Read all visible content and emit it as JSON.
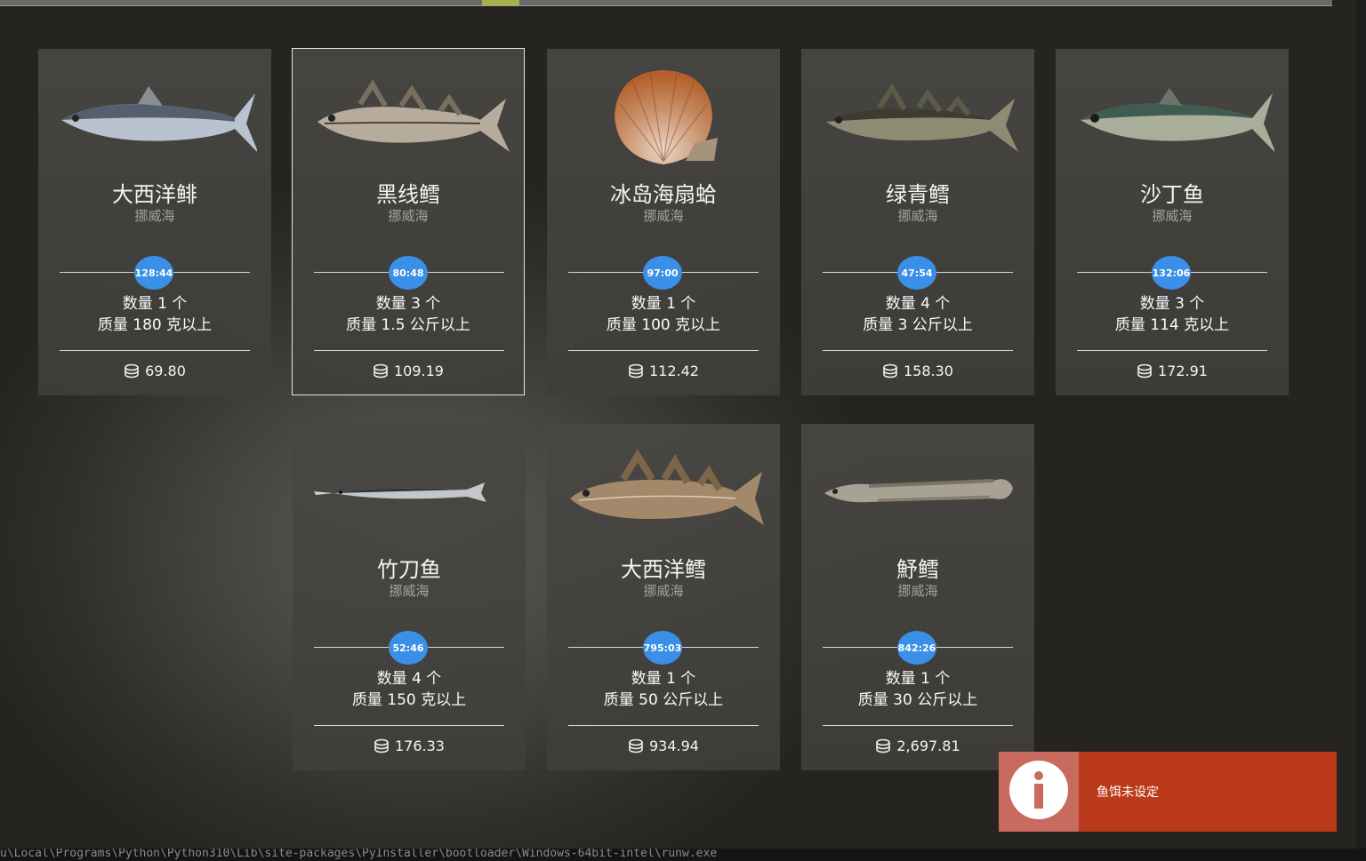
{
  "cards": [
    {
      "name": "大西洋鲱",
      "region": "挪威海",
      "timer": "128:44",
      "qty": "数量 1 个",
      "weight": "质量 180 克以上",
      "price": "69.80"
    },
    {
      "name": "黑线鳕",
      "region": "挪威海",
      "timer": "80:48",
      "qty": "数量 3 个",
      "weight": "质量 1.5 公斤以上",
      "price": "109.19"
    },
    {
      "name": "冰岛海扇蛤",
      "region": "挪威海",
      "timer": "97:00",
      "qty": "数量 1 个",
      "weight": "质量 100 克以上",
      "price": "112.42"
    },
    {
      "name": "绿青鳕",
      "region": "挪威海",
      "timer": "47:54",
      "qty": "数量 4 个",
      "weight": "质量 3 公斤以上",
      "price": "158.30"
    },
    {
      "name": "沙丁鱼",
      "region": "挪威海",
      "timer": "132:06",
      "qty": "数量 3 个",
      "weight": "质量 114 克以上",
      "price": "172.91"
    },
    {
      "name": "竹刀鱼",
      "region": "挪威海",
      "timer": "52:46",
      "qty": "数量 4 个",
      "weight": "质量 150 克以上",
      "price": "176.33"
    },
    {
      "name": "大西洋鳕",
      "region": "挪威海",
      "timer": "795:03",
      "qty": "数量 1 个",
      "weight": "质量 50 公斤以上",
      "price": "934.94"
    },
    {
      "name": "魣鳕",
      "region": "挪威海",
      "timer": "842:26",
      "qty": "数量 1 个",
      "weight": "质量 30 公斤以上",
      "price": "2,697.81"
    }
  ],
  "toast": {
    "message": "鱼饵未设定",
    "icon": "info-icon"
  },
  "console_path": "u\\Local\\Programs\\Python\\Python310\\Lib\\site-packages\\PyInstaller\\bootloader\\Windows-64bit-intel\\runw.exe",
  "colors": {
    "timer": "#3a8fe6",
    "toast_bg": "#bb3a1b",
    "toast_icon_bg": "#c96a5e",
    "selected_border": "#e6e6e6"
  }
}
